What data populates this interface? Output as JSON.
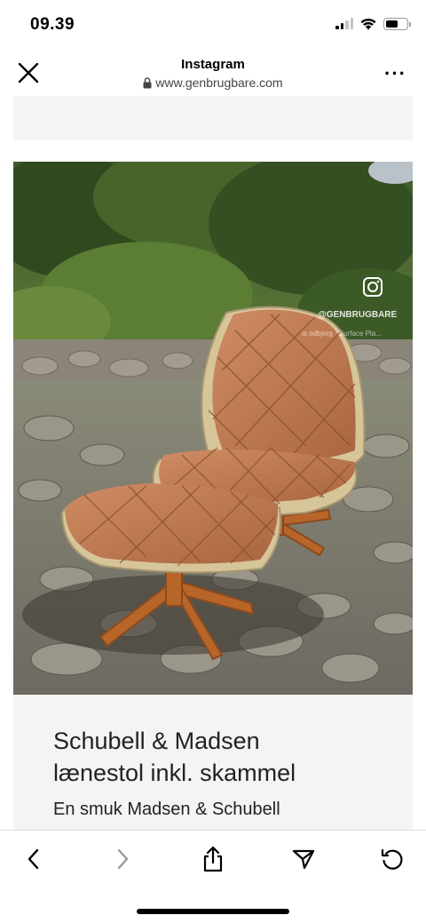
{
  "status": {
    "time": "09.39"
  },
  "browser": {
    "title": "Instagram",
    "url": "www.genbrugbare.com"
  },
  "image": {
    "watermark_handle": "@GENBRUGBARE",
    "watermark_sub": "is odbjerg · Surface Pla..."
  },
  "product": {
    "title_line1": "Schubell & Madsen",
    "title_line2": "lænestol inkl. skammel",
    "description": "En smuk Madsen & Schubell"
  },
  "colors": {
    "leather": "#c07a55",
    "wood": "#b8652a",
    "card_bg": "#f4f4f4"
  },
  "toolbar": {
    "icons": [
      "back-icon",
      "forward-icon",
      "share-icon",
      "send-icon",
      "reload-icon"
    ]
  }
}
